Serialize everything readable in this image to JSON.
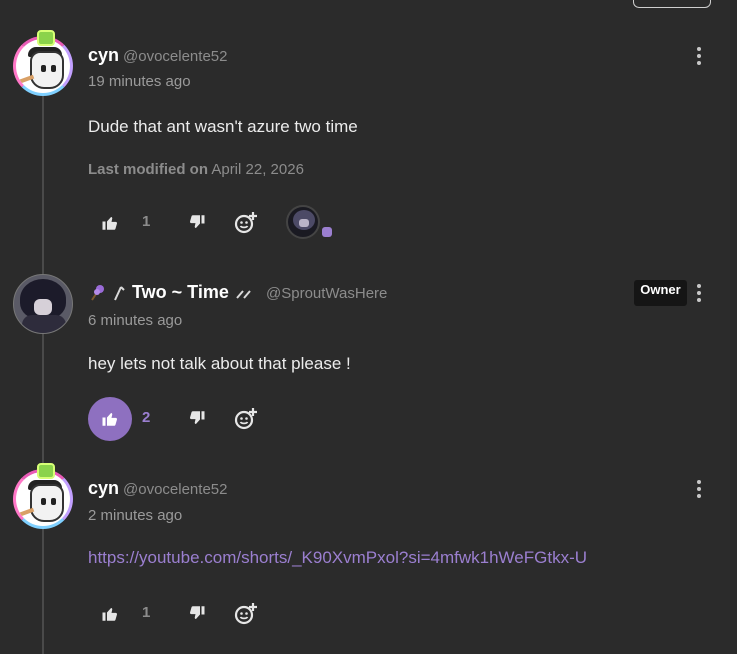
{
  "comments": [
    {
      "name": "cyn",
      "handle": "@ovocelente52",
      "time": "19 minutes ago",
      "body": "Dude that ant wasn't azure two time",
      "modified_label": "Last modified on",
      "modified_date": "April 22, 2026",
      "likes": "1",
      "liked": false
    },
    {
      "name": "Two ~ Time",
      "handle": "@SproutWasHere",
      "time": "6 minutes ago",
      "badge": "Owner",
      "body": "hey lets not talk about that please !",
      "likes": "2",
      "liked": true
    },
    {
      "name": "cyn",
      "handle": "@ovocelente52",
      "time": "2 minutes ago",
      "body": "https://youtube.com/shorts/_K90XvmPxol?si=4mfwk1hWeFGtkx-U",
      "likes": "1",
      "liked": false
    }
  ],
  "colors": {
    "background": "#2b2b2b",
    "accent": "#9b7fd0",
    "like_active_bg": "#8e70c0",
    "text": "#ececec",
    "muted": "#8c8c8c"
  },
  "icons": [
    "thumbs-up-icon",
    "thumbs-down-icon",
    "add-reaction-icon",
    "kebab-menu-icon",
    "lavender-icon",
    "sparkle-icon"
  ]
}
